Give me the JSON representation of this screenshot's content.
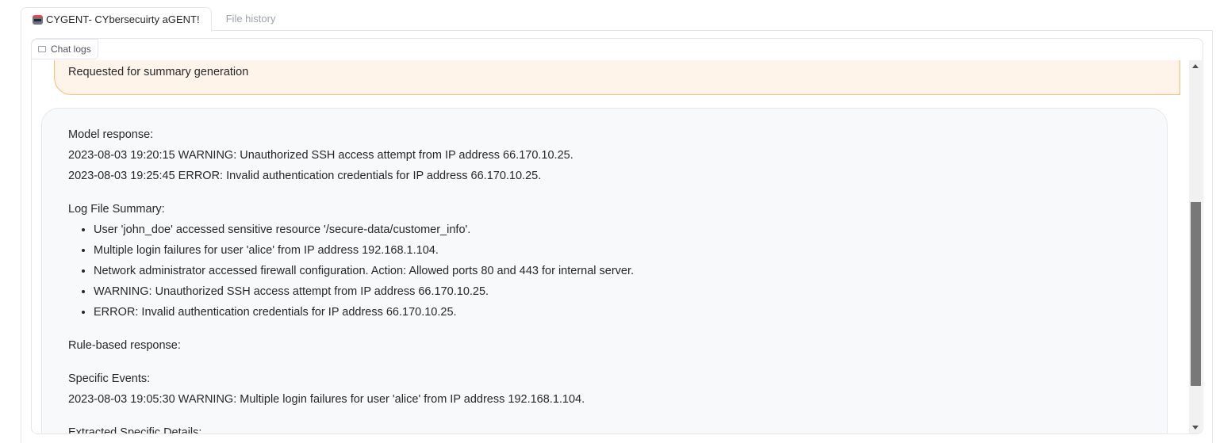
{
  "tabs": [
    {
      "label": "CYGENT- CYbersecuirty aGENT!",
      "icon": "robot-icon",
      "active": true
    },
    {
      "label": "File history",
      "active": false
    }
  ],
  "chatbot": {
    "label": "Chat logs",
    "icon": "chat-icon"
  },
  "messages": {
    "user": "Requested for summary generation",
    "bot": {
      "model_heading": "Model response:",
      "model_lines": [
        "2023-08-03 19:20:15 WARNING: Unauthorized SSH access attempt from IP address 66.170.10.25.",
        "2023-08-03 19:25:45 ERROR: Invalid authentication credentials for IP address 66.170.10.25."
      ],
      "summary_heading": "Log File Summary:",
      "summary_items": [
        "User 'john_doe' accessed sensitive resource '/secure-data/customer_info'.",
        "Multiple login failures for user 'alice' from IP address 192.168.1.104.",
        "Network administrator accessed firewall configuration. Action: Allowed ports 80 and 443 for internal server.",
        "WARNING: Unauthorized SSH access attempt from IP address 66.170.10.25.",
        "ERROR: Invalid authentication credentials for IP address 66.170.10.25."
      ],
      "rule_heading": "Rule-based response:",
      "events_heading": "Specific Events:",
      "events_line": "2023-08-03 19:05:30 WARNING: Multiple login failures for user 'alice' from IP address 192.168.1.104.",
      "extracted_heading": "Extracted Specific Details:"
    }
  },
  "colors": {
    "user_bubble": "#fff4ea",
    "user_border": "#fdba74",
    "bot_bubble": "#f8f9fa",
    "scroll_thumb": "#787878"
  }
}
